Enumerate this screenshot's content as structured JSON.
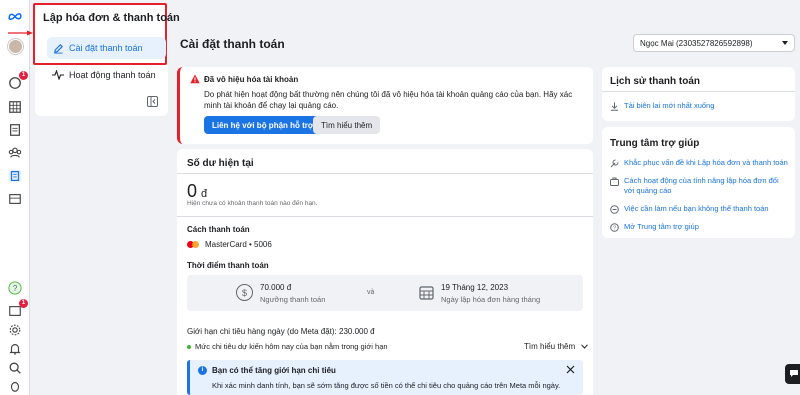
{
  "nav": {
    "title": "Lập hóa đơn & thanh toán",
    "items": [
      {
        "label": "Cài đặt thanh toán",
        "active": true
      },
      {
        "label": "Hoạt động thanh toán",
        "active": false
      }
    ]
  },
  "rail": {
    "badges": [
      "1",
      "1"
    ]
  },
  "header": {
    "title": "Cài đặt thanh toán",
    "account": "Ngọc Mai (2303527826592898)"
  },
  "alert": {
    "title": "Đã vô hiệu hóa tài khoản",
    "body": "Do phát hiện hoạt động bất thường nên chúng tôi đã vô hiệu hóa tài khoản quảng cáo của bạn. Hãy xác minh tài khoản để chạy lại quảng cáo.",
    "primary_button": "Liên hệ với bộ phận hỗ trợ",
    "secondary_button": "Tìm hiểu thêm"
  },
  "balance": {
    "title": "Số dư hiện tại",
    "amount": "0",
    "currency": "đ",
    "note": "Hiện chưa có khoản thanh toán nào đến hạn.",
    "payment_method_label": "Cách thanh toán",
    "payment_method": "MasterCard • 5006",
    "billing_time_label": "Thời điểm thanh toán",
    "threshold_value": "70.000 đ",
    "threshold_label": "Ngưỡng thanh toán",
    "and": "và",
    "billing_date": "19 Tháng 12, 2023",
    "billing_date_label": "Ngày lập hóa đơn hàng tháng",
    "daily_limit": "Giới hạn chi tiêu hàng ngày (do Meta đặt): 230.000 đ",
    "daily_limit_status": "Mức chi tiêu dự kiến hôm nay của bạn nằm trong giới hạn",
    "learn_more": "Tìm hiểu thêm",
    "info_title": "Bạn có thể tăng giới hạn chi tiêu",
    "info_body": "Khi xác minh danh tính, bạn sẽ sớm tăng được số tiền có thể chi tiêu cho quảng cáo trên Meta mỗi ngày."
  },
  "history": {
    "title": "Lịch sử thanh toán",
    "link": "Tải biên lai mới nhất xuống"
  },
  "help": {
    "title": "Trung tâm trợ giúp",
    "links": [
      "Khắc phục vấn đề khi Lập hóa đơn và thanh toán",
      "Cách hoạt động của tính năng lập hóa đơn đối với quảng cáo",
      "Việc cần làm nếu bạn không thể thanh toán",
      "Mở Trung tâm trợ giúp"
    ]
  },
  "colors": {
    "accent": "#1b74e4",
    "danger": "#e4202a",
    "success": "#42b72a"
  }
}
